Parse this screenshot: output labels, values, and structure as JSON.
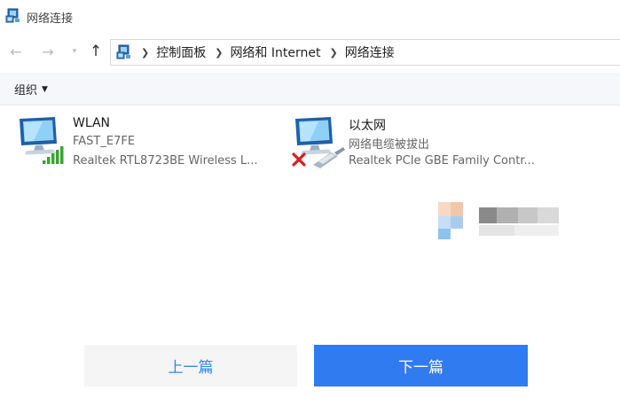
{
  "window": {
    "title": "网络连接"
  },
  "nav": {
    "back_icon": "back-arrow-icon",
    "forward_icon": "forward-arrow-icon",
    "up_icon": "up-arrow-icon",
    "breadcrumb": [
      "控制面板",
      "网络和 Internet",
      "网络连接"
    ]
  },
  "toolbar": {
    "organize_label": "组织"
  },
  "connections": [
    {
      "name": "WLAN",
      "status": "FAST_E7FE",
      "device": "Realtek RTL8723BE Wireless L...",
      "icon": "wireless-network-icon"
    },
    {
      "name": "以太网",
      "status": "网络电缆被拔出",
      "device": "Realtek PCIe GBE Family Contr...",
      "icon": "ethernet-disconnected-icon"
    }
  ],
  "pager": {
    "prev_label": "上一篇",
    "next_label": "下一篇"
  },
  "colors": {
    "next_button": "#2f7bef",
    "prev_button_text": "#2f8ae0",
    "disconnected_x": "#d32020",
    "signal_green": "#3da235"
  }
}
